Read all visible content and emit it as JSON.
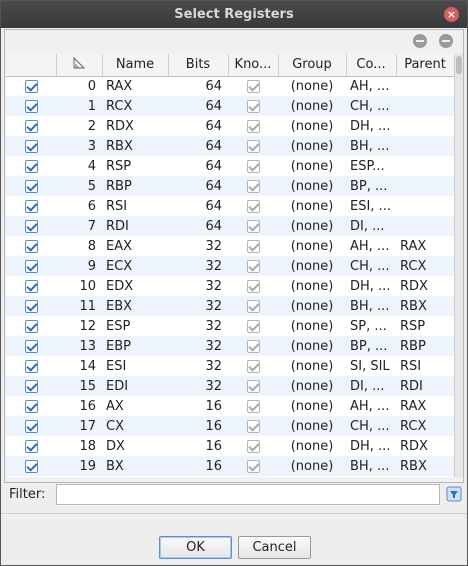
{
  "window": {
    "title": "Select Registers"
  },
  "table": {
    "columns": [
      "",
      "",
      "Name",
      "Bits",
      "Kno...",
      "Group",
      "Co...",
      "Parent"
    ],
    "rows": [
      {
        "index": "0",
        "name": "RAX",
        "bits": "64",
        "group": "(none)",
        "children": "AH, ...",
        "parent": ""
      },
      {
        "index": "1",
        "name": "RCX",
        "bits": "64",
        "group": "(none)",
        "children": "CH, ...",
        "parent": ""
      },
      {
        "index": "2",
        "name": "RDX",
        "bits": "64",
        "group": "(none)",
        "children": "DH, ...",
        "parent": ""
      },
      {
        "index": "3",
        "name": "RBX",
        "bits": "64",
        "group": "(none)",
        "children": "BH, ...",
        "parent": ""
      },
      {
        "index": "4",
        "name": "RSP",
        "bits": "64",
        "group": "(none)",
        "children": "ESP...",
        "parent": ""
      },
      {
        "index": "5",
        "name": "RBP",
        "bits": "64",
        "group": "(none)",
        "children": "BP, ...",
        "parent": ""
      },
      {
        "index": "6",
        "name": "RSI",
        "bits": "64",
        "group": "(none)",
        "children": "ESI, ...",
        "parent": ""
      },
      {
        "index": "7",
        "name": "RDI",
        "bits": "64",
        "group": "(none)",
        "children": "DI, ...",
        "parent": ""
      },
      {
        "index": "8",
        "name": "EAX",
        "bits": "32",
        "group": "(none)",
        "children": "AH, ...",
        "parent": "RAX"
      },
      {
        "index": "9",
        "name": "ECX",
        "bits": "32",
        "group": "(none)",
        "children": "CH, ...",
        "parent": "RCX"
      },
      {
        "index": "10",
        "name": "EDX",
        "bits": "32",
        "group": "(none)",
        "children": "DH, ...",
        "parent": "RDX"
      },
      {
        "index": "11",
        "name": "EBX",
        "bits": "32",
        "group": "(none)",
        "children": "BH, ...",
        "parent": "RBX"
      },
      {
        "index": "12",
        "name": "ESP",
        "bits": "32",
        "group": "(none)",
        "children": "SP, ...",
        "parent": "RSP"
      },
      {
        "index": "13",
        "name": "EBP",
        "bits": "32",
        "group": "(none)",
        "children": "BP, ...",
        "parent": "RBP"
      },
      {
        "index": "14",
        "name": "ESI",
        "bits": "32",
        "group": "(none)",
        "children": "SI, SIL",
        "parent": "RSI"
      },
      {
        "index": "15",
        "name": "EDI",
        "bits": "32",
        "group": "(none)",
        "children": "DI, ...",
        "parent": "RDI"
      },
      {
        "index": "16",
        "name": "AX",
        "bits": "16",
        "group": "(none)",
        "children": "AH, ...",
        "parent": "RAX"
      },
      {
        "index": "17",
        "name": "CX",
        "bits": "16",
        "group": "(none)",
        "children": "CH, ...",
        "parent": "RCX"
      },
      {
        "index": "18",
        "name": "DX",
        "bits": "16",
        "group": "(none)",
        "children": "DH, ...",
        "parent": "RDX"
      },
      {
        "index": "19",
        "name": "BX",
        "bits": "16",
        "group": "(none)",
        "children": "BH, ...",
        "parent": "RBX"
      }
    ]
  },
  "filter": {
    "label": "Filter:",
    "value": ""
  },
  "buttons": {
    "ok": "OK",
    "cancel": "Cancel"
  },
  "colors": {
    "row_alt": "#eef4fb",
    "title_bg": "#3f3f3f",
    "close": "#d35f5f"
  },
  "icons": {
    "sort": "sort-icon",
    "close": "close-icon",
    "filter_options": "filter-options-icon"
  }
}
